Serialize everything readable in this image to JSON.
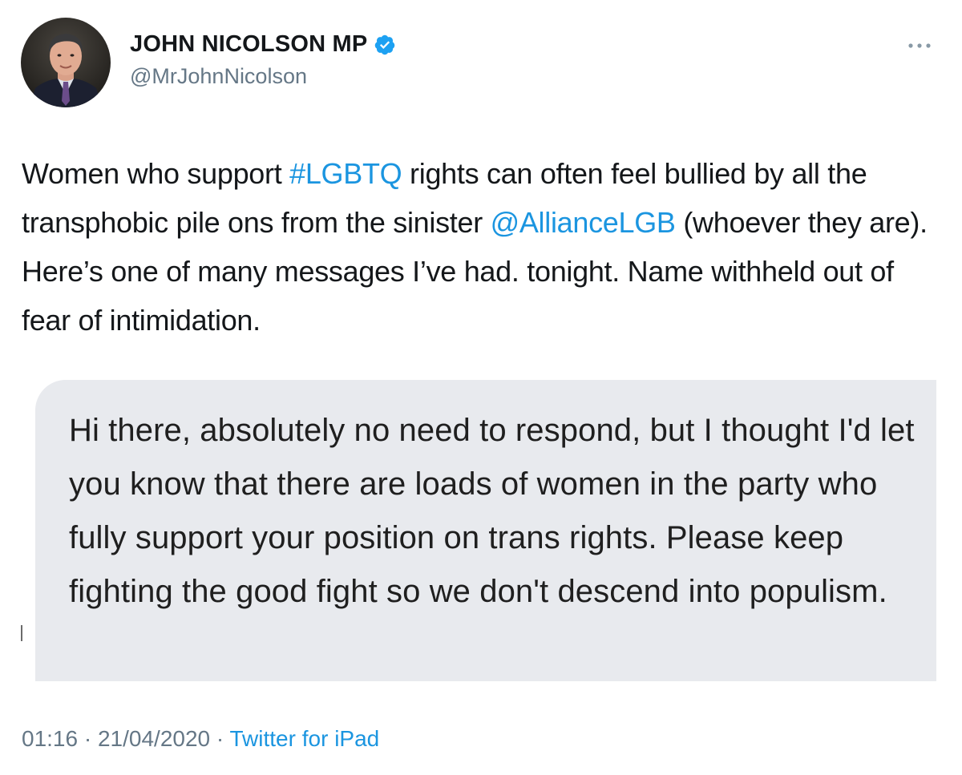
{
  "author": {
    "display_name": "JOHN NICOLSON MP",
    "handle": "@MrJohnNicolson",
    "verified_icon": "verified-badge-icon",
    "avatar_icon": "avatar"
  },
  "more_icon": "more-options-icon",
  "tweet": {
    "text_part1": "Women who support ",
    "hashtag": "#LGBTQ",
    "text_part2": " rights can often feel bullied by all the transphobic pile ons from the sinister ",
    "mention": "@AllianceLGB",
    "text_part3": " (whoever they are). Here’s one of many messages I’ve had. tonight. Name withheld out of fear of intimidation."
  },
  "media": {
    "message_text": "Hi there, absolutely no need to respond, but I thought I'd let you know that there are loads of women in the party who fully support your position on trans rights. Please keep fighting the good fight so we don't descend into populism."
  },
  "meta": {
    "time": "01:16",
    "separator": " · ",
    "date": "21/04/2020",
    "source": "Twitter for iPad"
  },
  "colors": {
    "link": "#1b95e0",
    "secondary_text": "#657786",
    "message_bubble": "#e8eaee"
  }
}
